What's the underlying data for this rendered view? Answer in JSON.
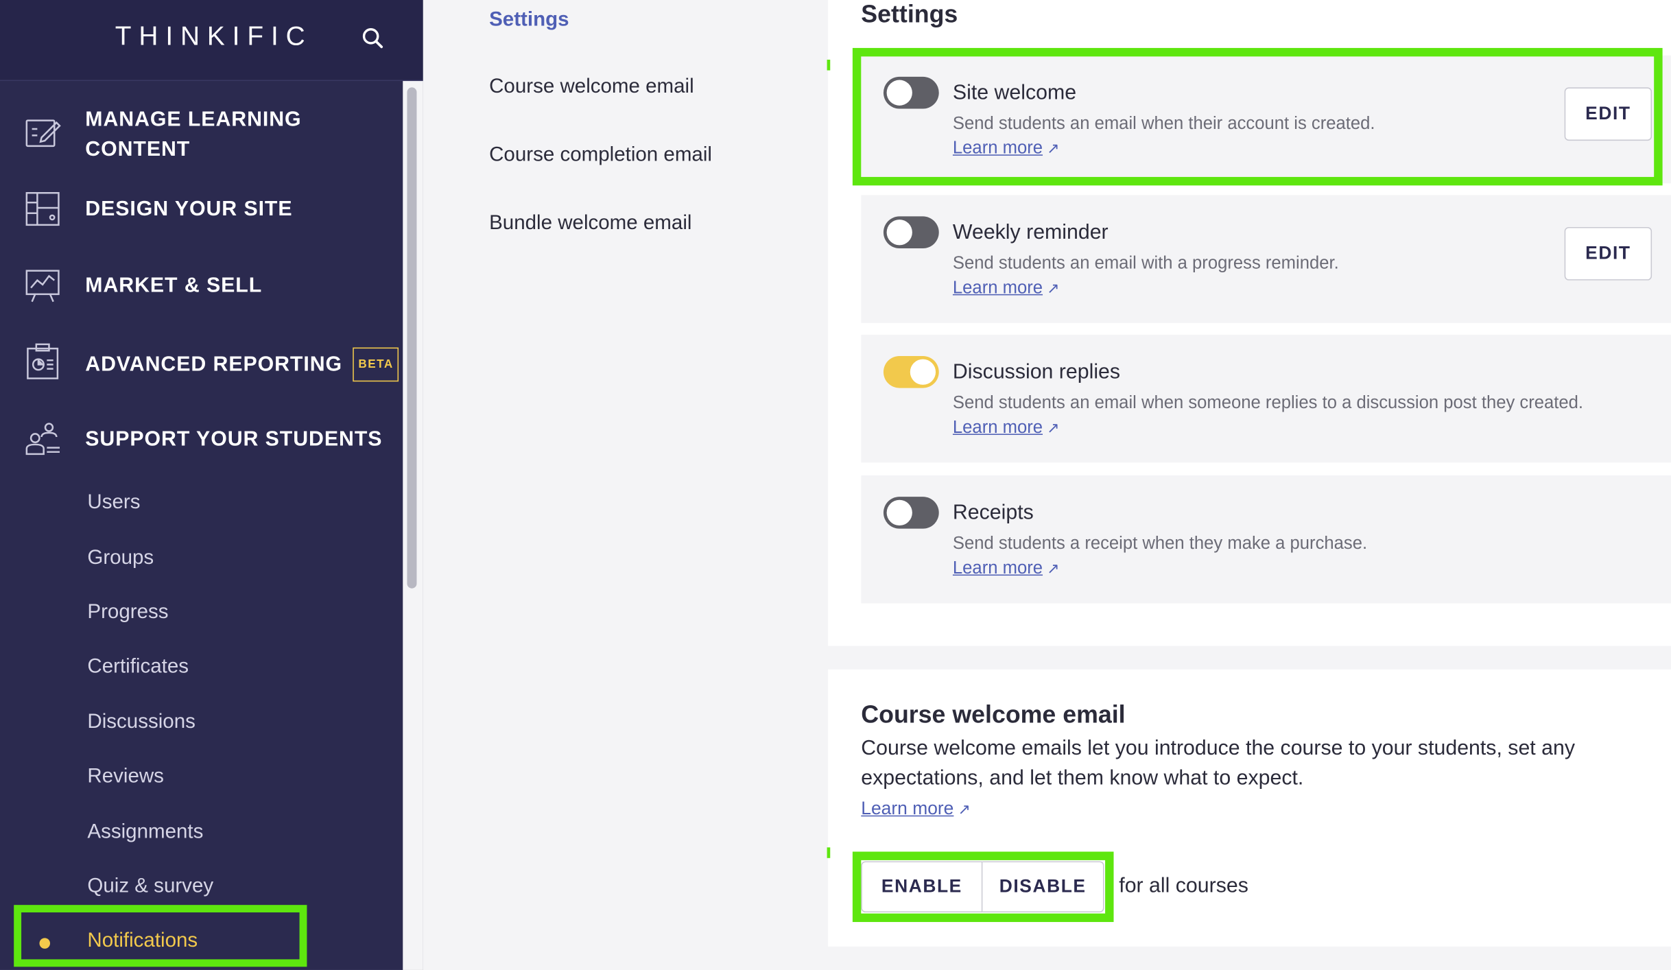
{
  "brand": {
    "logo": "THINKIFIC"
  },
  "colors": {
    "sidebar_bg": "#2b2a4f",
    "accent_yellow": "#f2c94c",
    "link_blue": "#4f5fb5",
    "highlight_green": "#5ee60f"
  },
  "sidebar": {
    "sections": [
      {
        "label_line1": "MANAGE LEARNING",
        "label_line2": "CONTENT",
        "icon": "edit-document-icon"
      },
      {
        "label": "DESIGN YOUR SITE",
        "icon": "layout-icon"
      },
      {
        "label": "MARKET & SELL",
        "icon": "presentation-chart-icon"
      },
      {
        "label": "ADVANCED REPORTING",
        "badge": "BETA",
        "icon": "clipboard-chart-icon"
      },
      {
        "label": "SUPPORT YOUR STUDENTS",
        "icon": "people-icon"
      }
    ],
    "sub_items": [
      "Users",
      "Groups",
      "Progress",
      "Certificates",
      "Discussions",
      "Reviews",
      "Assignments",
      "Quiz & survey",
      "Notifications"
    ],
    "active_item": "Notifications"
  },
  "subnav": {
    "items": [
      "Settings",
      "Course welcome email",
      "Course completion email",
      "Bundle welcome email"
    ],
    "active": "Settings"
  },
  "settings": {
    "title": "Settings",
    "rows": [
      {
        "title": "Site welcome",
        "desc": "Send students an email when their account is created.",
        "learn": "Learn more",
        "enabled": false,
        "edit": "EDIT"
      },
      {
        "title": "Weekly reminder",
        "desc": "Send students an email with a progress reminder.",
        "learn": "Learn more",
        "enabled": false,
        "edit": "EDIT"
      },
      {
        "title": "Discussion replies",
        "desc": "Send students an email when someone replies to a discussion post they created.",
        "learn": "Learn more",
        "enabled": true
      },
      {
        "title": "Receipts",
        "desc": "Send students a receipt when they make a purchase.",
        "learn": "Learn more",
        "enabled": false
      }
    ]
  },
  "course_welcome": {
    "title": "Course welcome email",
    "desc": "Course welcome emails let you introduce the course to your students, set any expectations, and let them know what to expect.",
    "learn": "Learn more",
    "enable": "ENABLE",
    "disable": "DISABLE",
    "suffix": "for all courses"
  },
  "ext_glyph": "↗"
}
